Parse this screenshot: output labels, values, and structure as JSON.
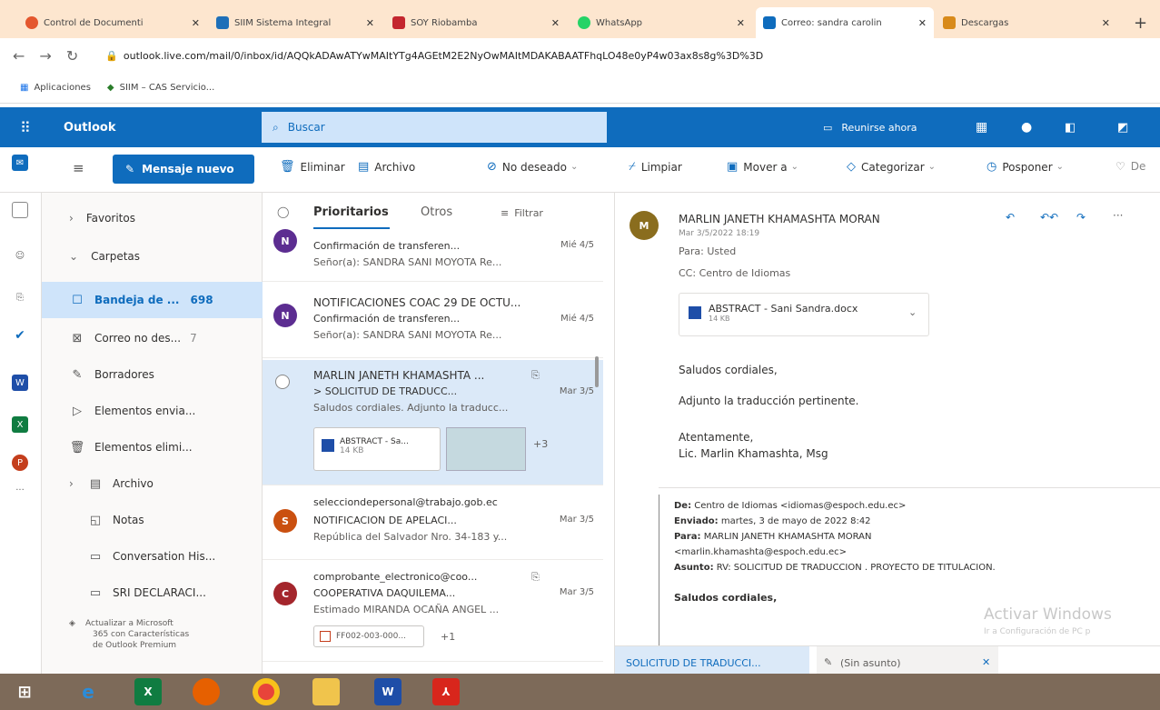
{
  "browser": {
    "tabs": [
      {
        "label": "Control de Documenti",
        "color": "#e4572e"
      },
      {
        "label": "SIIM Sistema Integral",
        "color": "#1e6fb8"
      },
      {
        "label": "SOY Riobamba",
        "color": "#c4262e"
      },
      {
        "label": "WhatsApp",
        "color": "#25d366"
      },
      {
        "label": "Correo: sandra carolin",
        "color": "#0f6cbd"
      },
      {
        "label": "Descargas",
        "color": "#d88a1a"
      }
    ],
    "url": "outlook.live.com/mail/0/inbox/id/AQQkADAwATYwMAItYTg4AGEtM2E2NyOwMAItMDAKABAATFhqLO48e0yP4w03ax8s8g%3D%3D",
    "bookmarks": [
      "Aplicaciones",
      "SIIM – CAS Servicio..."
    ]
  },
  "header": {
    "app_name": "Outlook",
    "search_placeholder": "Buscar",
    "meet_now": "Reunirse ahora"
  },
  "commands": {
    "new_message": "Mensaje nuevo",
    "delete": "Eliminar",
    "archive": "Archivo",
    "junk": "No deseado",
    "sweep": "Limpiar",
    "move_to": "Mover a",
    "categorize": "Categorizar",
    "snooze": "Posponer",
    "more": "De"
  },
  "folders": {
    "favorites": "Favoritos",
    "folders": "Carpetas",
    "items": [
      {
        "label": "Bandeja de ...",
        "count": "698"
      },
      {
        "label": "Correo no des...",
        "count": "7"
      },
      {
        "label": "Borradores",
        "count": ""
      },
      {
        "label": "Elementos envia...",
        "count": ""
      },
      {
        "label": "Elementos elimi...",
        "count": ""
      },
      {
        "label": "Archivo",
        "count": ""
      },
      {
        "label": "Notas",
        "count": ""
      },
      {
        "label": "Conversation His...",
        "count": ""
      },
      {
        "label": "SRI DECLARACI...",
        "count": ""
      }
    ],
    "upgrade": [
      "Actualizar a Microsoft",
      "365 con Características",
      "de Outlook Premium"
    ]
  },
  "list": {
    "focused": "Prioritarios",
    "other": "Otros",
    "filter": "Filtrar",
    "messages": [
      {
        "initial": "N",
        "color": "#5c2d91",
        "from": "",
        "subject": "Confirmación de transferen...",
        "date": "Mié 4/5",
        "preview": "Señor(a): SANDRA SANI MOYOTA Re..."
      },
      {
        "initial": "N",
        "color": "#5c2d91",
        "from": "NOTIFICACIONES COAC 29 DE OCTU...",
        "subject": "Confirmación de transferen...",
        "date": "Mié 4/5",
        "preview": "Señor(a): SANDRA SANI MOYOTA Re..."
      },
      {
        "initial": "",
        "color": "",
        "from": "MARLIN JANETH KHAMASHTA ...",
        "subject": "> SOLICITUD DE TRADUCC...",
        "date": "Mar 3/5",
        "preview": "Saludos cordiales. Adjunto la traducc...",
        "attachment": "ABSTRACT - Sa...",
        "attachment_size": "14 KB",
        "more": "+3"
      },
      {
        "initial": "S",
        "color": "#ca5010",
        "from": "selecciondepersonal@trabajo.gob.ec",
        "subject": "NOTIFICACION DE APELACI...",
        "date": "Mar 3/5",
        "preview": "República del Salvador Nro. 34-183 y..."
      },
      {
        "initial": "C",
        "color": "#a4262c",
        "from": "comprobante_electronico@coo...",
        "subject": "COOPERATIVA DAQUILEMA...",
        "date": "Mar 3/5",
        "preview": "Estimado MIRANDA OCAÑA ANGEL ...",
        "attachment": "FF002-003-000...",
        "more": "+1"
      }
    ]
  },
  "reading": {
    "sender_initial": "M",
    "sender_color": "#8a6d1e",
    "sender": "MARLIN JANETH KHAMASHTA MORAN",
    "datetime": "Mar 3/5/2022 18:19",
    "to": "Para: Usted",
    "cc": "CC: Centro de Idiomas",
    "attachment_name": "ABSTRACT - Sani Sandra.docx",
    "attachment_size": "14 KB",
    "body": [
      "Saludos cordiales,",
      "Adjunto la traducción pertinente.",
      "Atentamente,",
      "Lic. Marlin Khamashta, Msg"
    ],
    "quoted": {
      "from_label": "De:",
      "from": "Centro de Idiomas <idiomas@espoch.edu.ec>",
      "sent_label": "Enviado:",
      "sent": "martes, 3 de mayo de 2022 8:42",
      "to_label": "Para:",
      "to": "MARLIN JANETH KHAMASHTA MORAN",
      "to2": "<marlin.khamashta@espoch.edu.ec>",
      "subject_label": "Asunto:",
      "subject": "RV: SOLICITUD DE TRADUCCION . PROYECTO DE TITULACION.",
      "greeting": "Saludos cordiales,"
    },
    "watermark1": "Activar Windows",
    "watermark2": "Ir a Configuración de PC p"
  },
  "bottom_tabs": [
    "SOLICITUD DE TRADUCCI...",
    "(Sin asunto)"
  ]
}
